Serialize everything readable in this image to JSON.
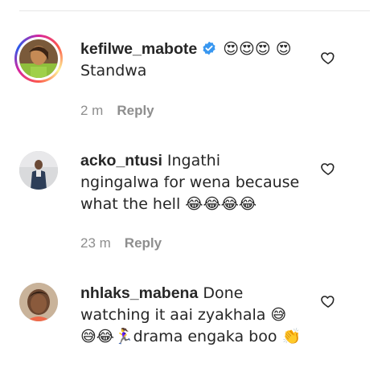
{
  "comments": [
    {
      "username": "kefilwe_mabote",
      "verified": true,
      "text": "😍😍😍 😍Standwa",
      "time": "2 m",
      "reply_label": "Reply"
    },
    {
      "username": "acko_ntusi",
      "verified": false,
      "text": "Ingathi ngingalwa for wena because what the hell 😂😂😂😂",
      "time": "23 m",
      "reply_label": "Reply"
    },
    {
      "username": "nhlaks_mabena",
      "verified": false,
      "text": "Done watching it aai zyakhala 😅 😅😂🏃‍♀️drama engaka boo 👏",
      "time": "",
      "reply_label": ""
    }
  ],
  "colors": {
    "text": "#262626",
    "muted": "#8e8e8e",
    "verified_blue": "#3897f0"
  },
  "icons": [
    "heart-outline-icon",
    "verified-badge-icon"
  ]
}
